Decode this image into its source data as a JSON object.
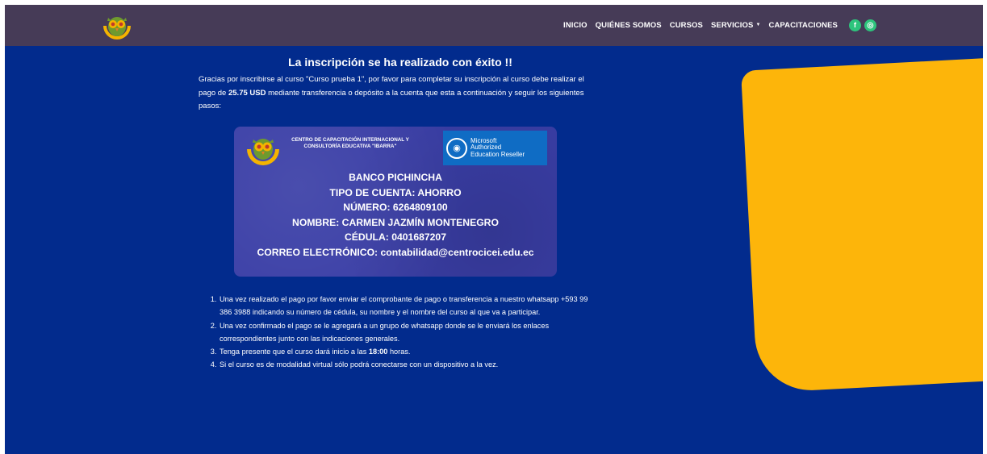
{
  "navbar": {
    "logo_icon": "owl-logo-icon",
    "items": [
      {
        "label": "INICIO"
      },
      {
        "label": "QUIÉNES SOMOS"
      },
      {
        "label": "CURSOS"
      },
      {
        "label": "SERVICIOS"
      },
      {
        "label": "CAPACITACIONES"
      }
    ],
    "social": [
      {
        "icon": "facebook-icon",
        "glyph": "f"
      },
      {
        "icon": "instagram-icon",
        "glyph": "◎"
      }
    ]
  },
  "main": {
    "title": "La inscripción se ha realizado con éxito !!",
    "intro_1": "Gracias por inscribirse al curso \"Curso prueba 1\", por favor para completar su inscripción al curso debe realizar el pago de ",
    "amount": "25.75 USD",
    "intro_2": " mediante transferencia o depósito a la cuenta que esta a continuación y seguir los siguientes pasos:"
  },
  "card": {
    "institution": "CENTRO DE CAPACITACIÓN INTERNACIONAL Y CONSULTORÍA EDUCATIVA \"IBARRA\"",
    "ms_line1": "Microsoft",
    "ms_line2": "Authorized",
    "ms_line3": "Education Reseller",
    "bank": "BANCO PICHINCHA",
    "account_type": "TIPO DE CUENTA: AHORRO",
    "number": "NÚMERO: 6264809100",
    "name": "NOMBRE: CARMEN JAZMÍN MONTENEGRO",
    "id": "CÉDULA: 0401687207",
    "email": "CORREO ELECTRÓNICO: contabilidad@centrocicei.edu.ec"
  },
  "steps": {
    "step1": "Una vez realizado el pago por favor enviar el comprobante de pago o transferencia a nuestro whatsapp +593 99 386 3988 indicando su número de cédula, su nombre y el nombre del curso al que va a participar.",
    "step2": "Una vez confirmado el pago se le agregará a un grupo de whatsapp donde se le enviará los enlaces correspondientes junto con las indicaciones generales.",
    "step3_pre": "Tenga presente que el curso dará inicio a las ",
    "step3_time": "18:00",
    "step3_post": " horas.",
    "step4": "Si el curso es de modalidad virtual sólo podrá conectarse con un dispositivo a la vez."
  },
  "colors": {
    "navbar": "#463b57",
    "background": "#022b8d",
    "accent_yellow": "#fdb50a",
    "social_green": "#2dc47c"
  }
}
